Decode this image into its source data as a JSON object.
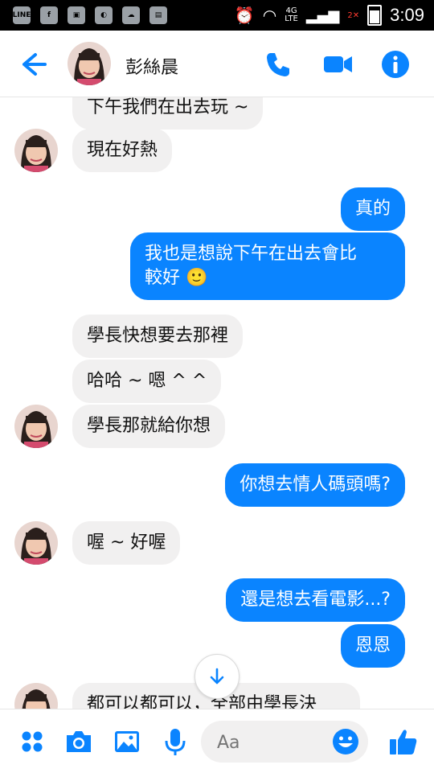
{
  "status_bar": {
    "time": "3:09",
    "network": "4G",
    "network_sub": "LTE",
    "sim_slot": "2"
  },
  "header": {
    "contact_name": "彭絲晨"
  },
  "messages": [
    {
      "direction": "in",
      "text": "下午我們在出去玩 ~"
    },
    {
      "direction": "in",
      "text": "現在好熱"
    },
    {
      "direction": "out",
      "text": "真的"
    },
    {
      "direction": "out",
      "text": "我也是想說下午在出去會比"
    },
    {
      "direction": "out",
      "text": "較好 🙂"
    },
    {
      "direction": "in",
      "text": "學長快想要去那裡"
    },
    {
      "direction": "in",
      "text": "哈哈 ~ 嗯 ^ ^"
    },
    {
      "direction": "in",
      "text": "學長那就給你想"
    },
    {
      "direction": "out",
      "text": "你想去情人碼頭嗎?"
    },
    {
      "direction": "in",
      "text": "喔 ~ 好喔"
    },
    {
      "direction": "out",
      "text": "還是想去看電影...?"
    },
    {
      "direction": "out",
      "text": "恩恩"
    },
    {
      "direction": "in",
      "text": "都可以都可以，全部由學長決"
    }
  ],
  "composer": {
    "placeholder": "Aa"
  },
  "colors": {
    "accent": "#0a84ff",
    "incoming_bubble": "#f1f0f0"
  }
}
